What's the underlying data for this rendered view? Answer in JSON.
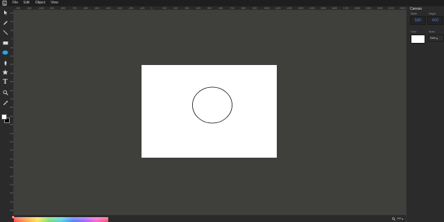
{
  "menubar": {
    "logo_icon": "app-logo-icon",
    "items": [
      {
        "label": "File"
      },
      {
        "label": "Edit"
      },
      {
        "label": "Object"
      },
      {
        "label": "View"
      }
    ]
  },
  "ruler": {
    "top_labels": [
      "-150",
      "-100",
      "-1000",
      "-900",
      "-800",
      "-700",
      "-600",
      "-500",
      "-400",
      "-300",
      "-200",
      "-100",
      "0",
      "100",
      "200",
      "300",
      "400",
      "500",
      "600",
      "700",
      "800",
      "900",
      "1000",
      "1100",
      "1200",
      "1300",
      "1400",
      "1500",
      "1600",
      "1700",
      "1800",
      "1900",
      "2000",
      "2100",
      "2150"
    ],
    "left_labels": [
      "-300",
      "-200",
      "-100",
      "0",
      "100",
      "200",
      "300",
      "400",
      "500",
      "600",
      "700",
      "800",
      "900",
      "1000",
      "1100",
      "1200",
      "1300",
      "1400",
      "1500",
      "1600",
      "1700",
      "1800",
      "1900",
      "2000"
    ]
  },
  "toolbar": {
    "tools": [
      {
        "icon": "select-arrow-icon"
      },
      {
        "icon": "pencil-icon"
      },
      {
        "icon": "line-icon"
      },
      {
        "icon": "rectangle-icon"
      },
      {
        "icon": "ellipse-icon",
        "active": true
      },
      {
        "icon": "pen-tool-icon"
      },
      {
        "icon": "star-icon"
      },
      {
        "icon": "text-icon",
        "glyph": "T"
      },
      {
        "icon": "zoom-icon"
      },
      {
        "icon": "eyedropper-icon"
      }
    ],
    "fill_color": "#ffffff",
    "stroke_color": "#000000",
    "active_color": "#29a6e8"
  },
  "canvas": {
    "background": "#ffffff",
    "shapes": [
      {
        "type": "ellipse",
        "fill": "none",
        "stroke": "#000000"
      }
    ]
  },
  "panel": {
    "title": "Canvas",
    "width_label": "Width",
    "width_value": "580",
    "height_label": "Height",
    "height_value": "400",
    "color_label": "Color",
    "color_value": "#ffffff",
    "sizes_label": "Sizes",
    "sizes_value": "Nam",
    "sizes_caret": "▾"
  },
  "bottombar": {
    "zoom_value": "100",
    "zoom_caret": "▾"
  },
  "colors": {
    "workspace": "#3f3f3b",
    "chrome": "#2b2b2b",
    "menubar": "#1e1e1e",
    "field_text": "#5a6fc8"
  }
}
